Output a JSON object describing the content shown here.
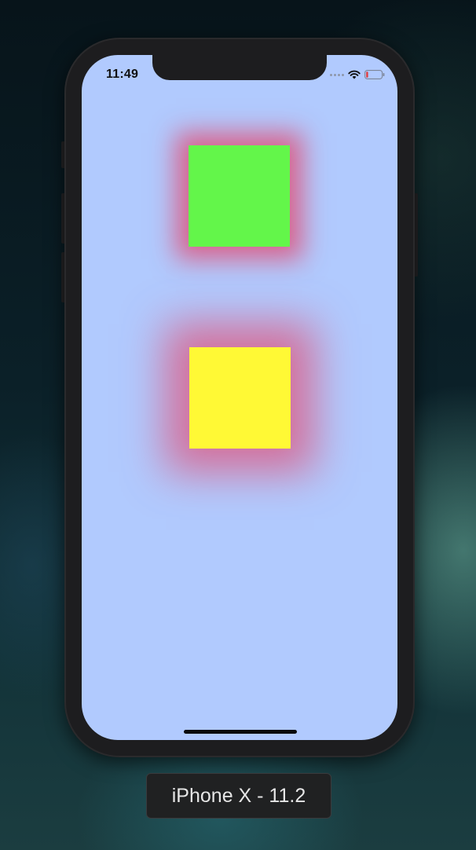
{
  "status_bar": {
    "time": "11:49",
    "icons": [
      "signal-dots-icon",
      "wifi-icon",
      "battery-low-icon"
    ]
  },
  "squares": [
    {
      "name": "green-square",
      "color": "#63f64a",
      "shadow_color": "#e05078"
    },
    {
      "name": "yellow-square",
      "color": "#fff935",
      "shadow_color": "#e05078"
    }
  ],
  "screen": {
    "background_color": "#b1cafe"
  },
  "simulator": {
    "device_label": "iPhone X - 11.2"
  }
}
